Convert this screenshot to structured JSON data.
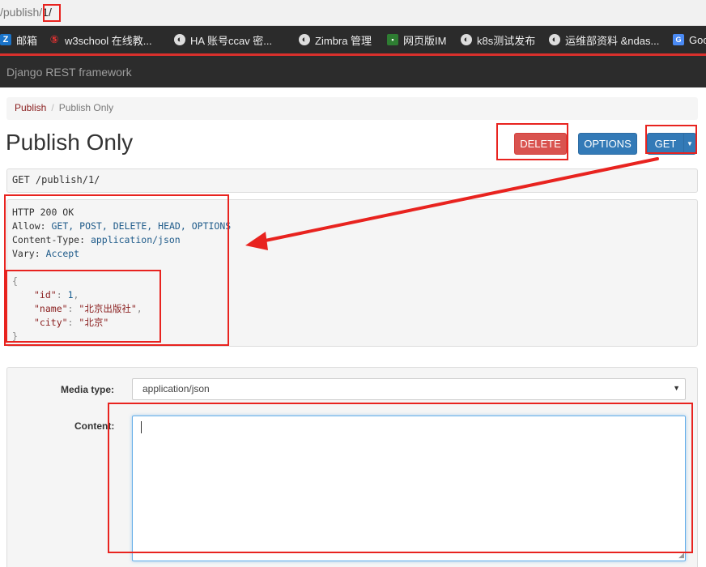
{
  "browser": {
    "url_prefix": "/publish/",
    "url_highlight": "1/"
  },
  "bookmarks": [
    {
      "label": "邮箱",
      "icon": "zimbra-z-icon"
    },
    {
      "label": "w3school 在线教...",
      "icon": "w3school-icon"
    },
    {
      "label": "HA  账号ccav  密...",
      "icon": "globe-icon"
    },
    {
      "label": "Zimbra 管理",
      "icon": "globe-icon"
    },
    {
      "label": "网页版IM",
      "icon": "im-icon"
    },
    {
      "label": "k8s测试发布",
      "icon": "globe-icon"
    },
    {
      "label": "运维部资料 &ndas...",
      "icon": "globe-icon"
    },
    {
      "label": "Goo",
      "icon": "google-translate-icon"
    }
  ],
  "navbar": {
    "brand": "Django REST framework"
  },
  "breadcrumb": {
    "parent": "Publish",
    "current": "Publish Only"
  },
  "page": {
    "title": "Publish Only"
  },
  "buttons": {
    "delete": "DELETE",
    "options": "OPTIONS",
    "get": "GET"
  },
  "request": {
    "method": "GET",
    "path": "/publish/1/"
  },
  "response": {
    "status": "HTTP 200 OK",
    "allow_label": "Allow:",
    "allow_methods": [
      "GET",
      "POST",
      "DELETE",
      "HEAD",
      "OPTIONS"
    ],
    "content_type_label": "Content-Type:",
    "content_type": "application/json",
    "vary_label": "Vary:",
    "vary": "Accept",
    "body": {
      "id": 1,
      "name": "北京出版社",
      "city": "北京"
    }
  },
  "form": {
    "media_type_label": "Media type:",
    "media_type": "application/json",
    "content_label": "Content:",
    "content": ""
  },
  "colors": {
    "annotation": "#e8231f",
    "delete": "#d9534f",
    "primary": "#337ab7",
    "navbar": "#2c2c2c"
  }
}
